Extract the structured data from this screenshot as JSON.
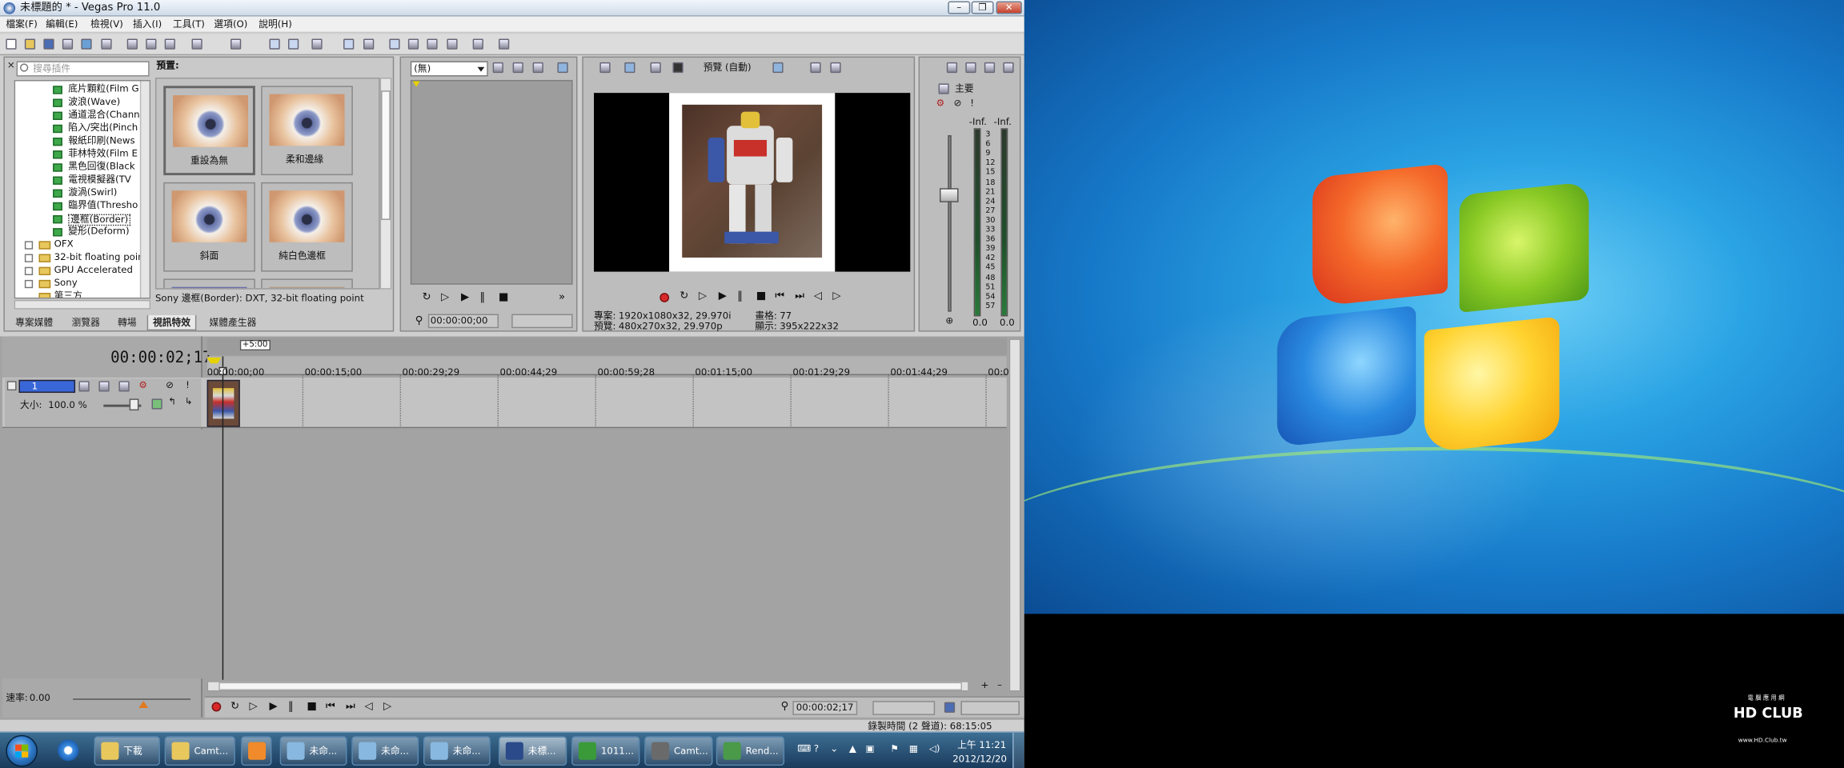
{
  "window": {
    "title": "未標題的 * - Vegas Pro 11.0"
  },
  "menu": [
    "檔案(F)",
    "編輯(E)",
    "檢視(V)",
    "插入(I)",
    "工具(T)",
    "選項(O)",
    "說明(H)"
  ],
  "fx_panel": {
    "search_placeholder": "搜尋插件",
    "tree_items": [
      "底片顆粒(Film G",
      "波浪(Wave)",
      "通道混合(Chann",
      "陷入/突出(Pinch",
      "報紙印刷(News",
      "菲林特效(Film E",
      "黑色回復(Black",
      "電視模擬器(TV",
      "漩渦(Swirl)",
      "臨界值(Thresho",
      "邊框(Border)",
      "變形(Deform)"
    ],
    "tree_folders": [
      "OFX",
      "32-bit floating poin",
      "GPU Accelerated",
      "Sony",
      "第三方"
    ],
    "preset_heading": "預置:",
    "presets": [
      "重設為無",
      "柔和邊緣",
      "斜面",
      "純白色邊框"
    ],
    "description": "Sony 邊框(Border): DXT, 32-bit floating point"
  },
  "tabs": [
    "專案媒體",
    "瀏覽器",
    "轉場",
    "視訊特效",
    "媒體產生器"
  ],
  "trimmer": {
    "select_value": "(無)",
    "timecode": "00:00:00;00"
  },
  "preview": {
    "mode": "預覽 (自動)",
    "info": {
      "project_label": "專案:",
      "project_value": "1920x1080x32, 29.970i",
      "preview_label": "預覽:",
      "preview_value": "480x270x32, 29.970p",
      "frame_label": "畫格:",
      "frame_value": "77",
      "display_label": "顯示:",
      "display_value": "395x222x32"
    }
  },
  "mixer": {
    "title": "主要",
    "left_peak": "-Inf.",
    "right_peak": "-Inf.",
    "scale": [
      "3",
      "6",
      "9",
      "12",
      "15",
      "18",
      "21",
      "24",
      "27",
      "30",
      "33",
      "36",
      "39",
      "42",
      "45",
      "48",
      "51",
      "54",
      "57"
    ],
    "left_value": "0.0",
    "right_value": "0.0"
  },
  "timeline": {
    "timecode": "00:00:02;17",
    "marker": "+5:00",
    "ruler": [
      "00:00:00;00",
      "00:00:15;00",
      "00:00:29;29",
      "00:00:44;29",
      "00:00:59;28",
      "00:01:15;00",
      "00:01:29;29",
      "00:01:44;29",
      "00:0"
    ],
    "track": {
      "number": "1",
      "level_label": "大小:",
      "level_value": "100.0 %"
    },
    "rate_label": "速率:",
    "rate_value": "0.00",
    "transport_timecode": "00:00:02;17",
    "status": "錄製時間 (2 聲道): 68:15:05"
  },
  "taskbar": {
    "tasks": [
      "下載",
      "Camt...",
      "",
      "未命...",
      "未命...",
      "未命...",
      "未標...",
      "1011...",
      "Camt...",
      "Rend..."
    ],
    "clock_time": "上午 11:21",
    "clock_date": "2012/12/20"
  },
  "watermark": {
    "logo": "HD CLUB",
    "top_text": "電 腦 應 用 網",
    "url": "www.HD.Club.tw"
  },
  "colors": {
    "selection": "#3a67d8",
    "desktop_blue": "#1a86d4",
    "taskbar": "#27496b"
  }
}
